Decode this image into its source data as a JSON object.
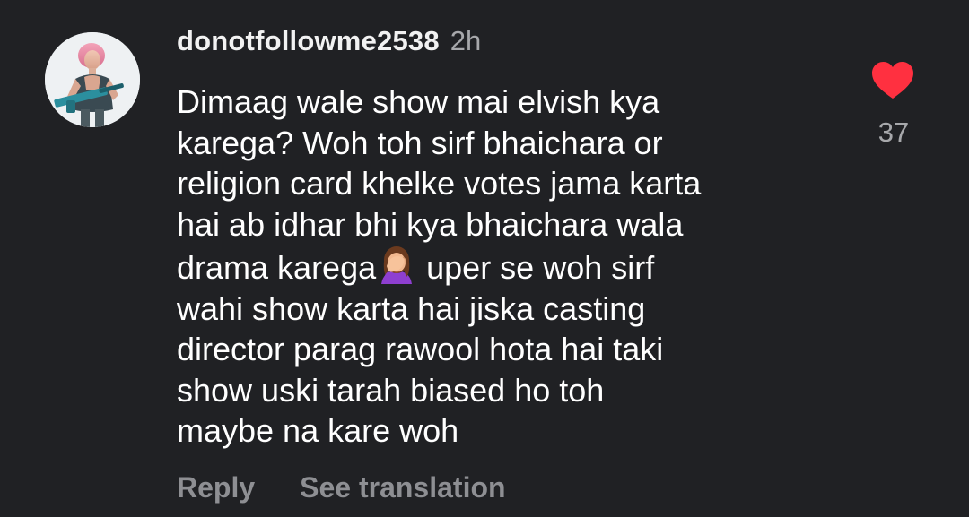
{
  "comment": {
    "username": "donotfollowme2538",
    "timestamp": "2h",
    "text_lines": [
      "Dimaag wale show mai elvish kya",
      "karega? Woh toh sirf bhaichara or",
      "religion card khelke votes jama karta",
      "hai ab idhar bhi kya bhaichara wala",
      "drama karega",
      "uper se woh sirf",
      "wahi show karta hai jiska casting",
      "director parag rawool hota hai taki",
      "show uski tarah biased ho toh",
      "maybe na kare woh"
    ],
    "emoji": "woman-facepalming-emoji",
    "actions": {
      "reply": "Reply",
      "see_translation": "See translation"
    },
    "likes": {
      "count": "37",
      "liked": true,
      "icon": "heart-icon",
      "color": "#ff3040"
    }
  },
  "theme": {
    "background": "#202124",
    "text": "#ffffff",
    "muted": "#a7a8ab"
  }
}
